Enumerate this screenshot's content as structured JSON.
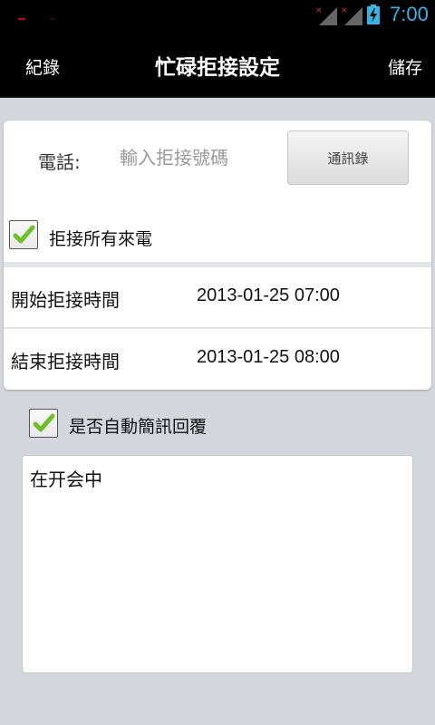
{
  "status_bar": {
    "time": "7:00",
    "icons": [
      "notification-icon",
      "signal-no-service-icon",
      "signal-no-service-icon",
      "battery-charging-icon"
    ],
    "accent_color": "#33b5e5"
  },
  "action_bar": {
    "left_label": "紀錄",
    "title": "忙碌拒接設定",
    "right_label": "儲存"
  },
  "phone": {
    "label": "電話:",
    "placeholder": "輸入拒接號碼",
    "value": "",
    "contacts_button": "通訊錄"
  },
  "reject_all": {
    "label": "拒接所有來電",
    "checked": true
  },
  "start_time": {
    "label": "開始拒接時間",
    "value": "2013-01-25 07:00"
  },
  "end_time": {
    "label": "結束拒接時間",
    "value": "2013-01-25 08:00"
  },
  "auto_reply": {
    "label": "是否自動簡訊回覆",
    "checked": true,
    "message": "在开会中"
  },
  "colors": {
    "check_green": "#6ec02a",
    "background": "#d4d6dd"
  }
}
